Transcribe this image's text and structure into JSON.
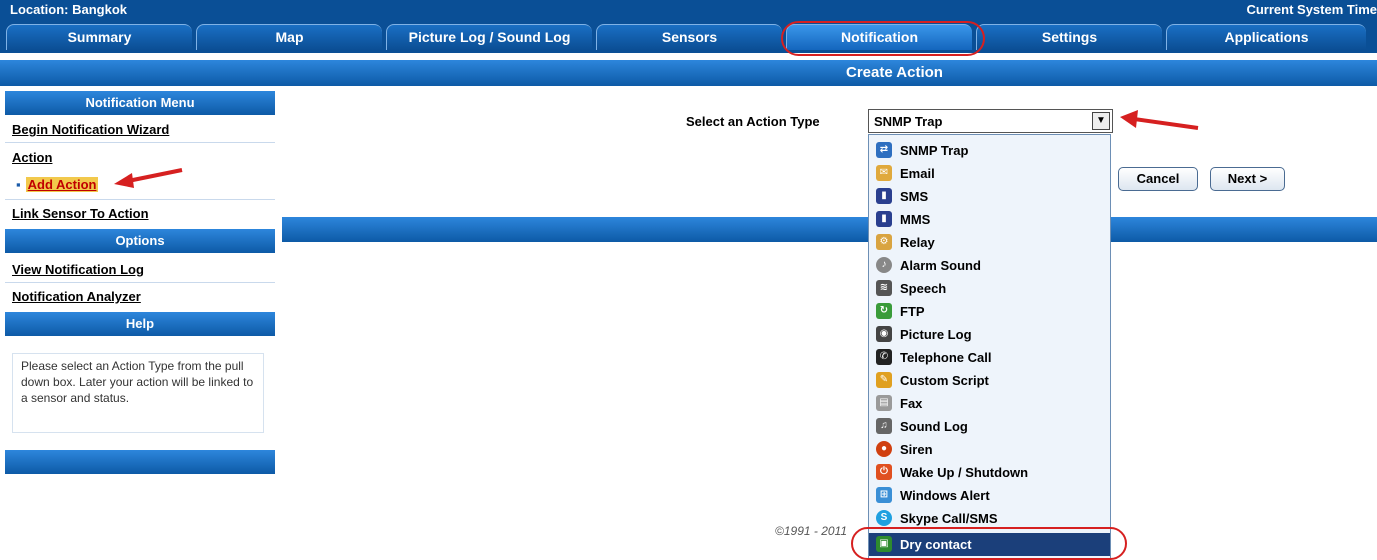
{
  "top_bar": {
    "location": "Location: Bangkok",
    "system_time_label": "Current System Time"
  },
  "tabs": [
    {
      "label": "Summary"
    },
    {
      "label": "Map"
    },
    {
      "label": "Picture Log / Sound Log"
    },
    {
      "label": "Sensors"
    },
    {
      "label": "Notification"
    },
    {
      "label": "Settings"
    },
    {
      "label": "Applications"
    }
  ],
  "page_title": "Create Action",
  "sidebar": {
    "notification_menu_title": "Notification Menu",
    "begin_wizard": "Begin Notification Wizard",
    "action": "Action",
    "add_action": "Add Action",
    "link_sensor": "Link Sensor To Action",
    "options_title": "Options",
    "view_log": "View Notification Log",
    "analyzer": "Notification Analyzer",
    "help_title": "Help",
    "help_text": "Please select an Action Type from the pull down box. Later your action will be linked to a sensor and status."
  },
  "main": {
    "select_label": "Select an Action Type",
    "selected_value": "SNMP Trap",
    "cancel_label": "Cancel",
    "next_label": "Next >",
    "copyright": "©1991 - 2011"
  },
  "action_types": [
    {
      "label": "SNMP Trap",
      "icon": "network-icon",
      "color": "#2e6fc0"
    },
    {
      "label": "Email",
      "icon": "envelope-icon",
      "color": "#e0a93c"
    },
    {
      "label": "SMS",
      "icon": "phone-icon",
      "color": "#2a3f8f"
    },
    {
      "label": "MMS",
      "icon": "phone-icon",
      "color": "#2a3f8f"
    },
    {
      "label": "Relay",
      "icon": "relay-icon",
      "color": "#d9a441"
    },
    {
      "label": "Alarm Sound",
      "icon": "speaker-icon",
      "color": "#888888"
    },
    {
      "label": "Speech",
      "icon": "speech-icon",
      "color": "#555555"
    },
    {
      "label": "FTP",
      "icon": "ftp-icon",
      "color": "#3a9b3a"
    },
    {
      "label": "Picture Log",
      "icon": "camera-icon",
      "color": "#444444"
    },
    {
      "label": "Telephone Call",
      "icon": "telephone-icon",
      "color": "#222222"
    },
    {
      "label": "Custom Script",
      "icon": "pencil-icon",
      "color": "#e0a020"
    },
    {
      "label": "Fax",
      "icon": "fax-icon",
      "color": "#9a9a9a"
    },
    {
      "label": "Sound Log",
      "icon": "microphone-icon",
      "color": "#666666"
    },
    {
      "label": "Siren",
      "icon": "siren-icon",
      "color": "#d04010"
    },
    {
      "label": "Wake Up / Shutdown",
      "icon": "power-icon",
      "color": "#e05020"
    },
    {
      "label": "Windows Alert",
      "icon": "windows-icon",
      "color": "#3a8fd6"
    },
    {
      "label": "Skype Call/SMS",
      "icon": "skype-icon",
      "color": "#1fa0e0"
    },
    {
      "label": "Dry contact",
      "icon": "contact-icon",
      "color": "#2e8b2e"
    }
  ],
  "colors": {
    "header_blue": "#0a4f96",
    "annotation_red": "#d62020",
    "selected_row": "#1b3f7a"
  }
}
